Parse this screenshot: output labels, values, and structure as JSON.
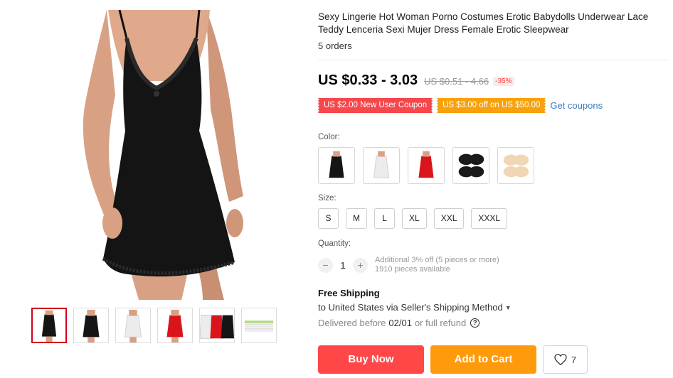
{
  "product": {
    "title": "Sexy Lingerie Hot Woman Porno Costumes Erotic Babydolls Underwear Lace Teddy Lenceria Sexi Mujer Dress Female Erotic Sleepwear",
    "orders": "5 orders",
    "price": "US $0.33 - 3.03",
    "original_price": "US $0.51 - 4.66",
    "discount": "-35%"
  },
  "coupons": [
    {
      "label": "US $2.00 New User Coupon",
      "color": "#f5474c"
    },
    {
      "label": "US $3.00 off on US $50.00",
      "color": "#f7a20d"
    }
  ],
  "get_coupons": "Get coupons",
  "color_label": "Color:",
  "colors": [
    "black",
    "white",
    "red",
    "black-pad",
    "nude-pad"
  ],
  "size_label": "Size:",
  "sizes": [
    "S",
    "M",
    "L",
    "XL",
    "XXL",
    "XXXL"
  ],
  "quantity": {
    "label": "Quantity:",
    "minus": "−",
    "value": "1",
    "plus": "+",
    "promo": "Additional 3% off (5 pieces or more)",
    "available": "1910 pieces available"
  },
  "shipping": {
    "title": "Free Shipping",
    "destination": "to United States via Seller's Shipping Method",
    "delivery_prefix": "Delivered before",
    "delivery_date": "02/01",
    "delivery_suffix": "or full refund",
    "help_icon": "?"
  },
  "actions": {
    "buy_now": "Buy Now",
    "add_to_cart": "Add to Cart",
    "wishlist_count": "7"
  },
  "gallery": {
    "thumbnails": [
      "black-dress",
      "black-dress-front",
      "white-dress",
      "red-dress",
      "three-colors",
      "size-chart"
    ],
    "active_index": 0
  },
  "colors_palette": {
    "price_red": "#f44",
    "buy": "#ff4747",
    "cart": "#ff9a0c",
    "link": "#3a7bbd"
  }
}
